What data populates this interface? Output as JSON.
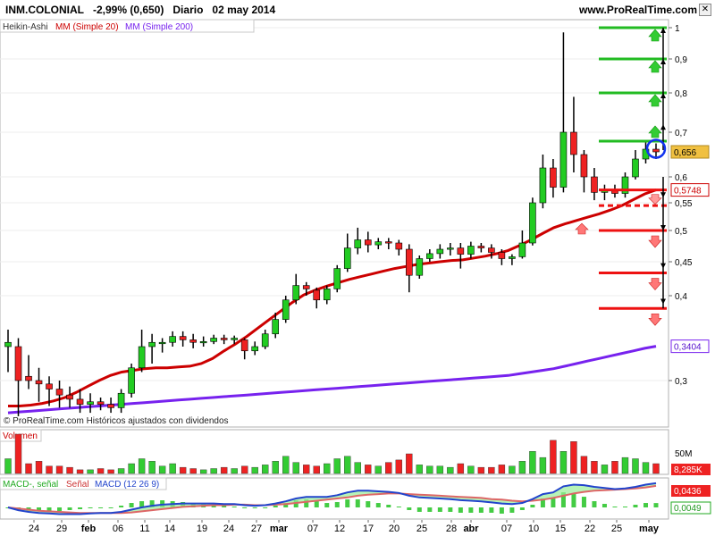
{
  "window": {
    "symbol": "INM.COLONIAL",
    "change": "-2,99% (0,650)",
    "period": "Diario",
    "date": "02 may 2014",
    "site": "www.ProRealTime.com"
  },
  "price_panel": {
    "legend": {
      "heikin": "Heikin-Ashi",
      "ma20": "MM (Simple 20)",
      "ma200": "MM (Simple 200)"
    },
    "watermark": "© ProRealTime.com Históricos ajustados con dividendos",
    "y_ticks": [
      "1",
      "0,9",
      "0,8",
      "0,7",
      "0,6",
      "0,55",
      "0,5",
      "0,45",
      "0,4",
      "0,3"
    ],
    "badges": {
      "last": "0,656",
      "ma20": "0,5748",
      "ma200": "0,3404"
    },
    "colors": {
      "up": "#22cc22",
      "down": "#ee2222",
      "ma20": "#cc0000",
      "ma200": "#7722ee",
      "last_badge": "#f0c040"
    }
  },
  "volume_panel": {
    "title": "Volumen",
    "y_ticks": [
      "50M",
      "8,285K"
    ]
  },
  "macd_panel": {
    "legend": {
      "macd_neg": "MACD-, señal",
      "signal": "Señal",
      "macd": "MACD (12 26 9)"
    },
    "badges": {
      "macd": "0,0436",
      "hist": "0,0049"
    }
  },
  "x_axis": {
    "labels": [
      "24",
      "29",
      "feb",
      "06",
      "11",
      "14",
      "19",
      "24",
      "27",
      "mar",
      "07",
      "12",
      "17",
      "20",
      "25",
      "28",
      "abr",
      "07",
      "10",
      "15",
      "22",
      "25",
      "may"
    ]
  },
  "chart_data": {
    "type": "candlestick",
    "series_ma": [
      {
        "name": "MM (Simple 20)",
        "values": [
          0.27,
          0.27,
          0.271,
          0.273,
          0.276,
          0.28,
          0.286,
          0.293,
          0.3,
          0.306,
          0.31,
          0.312,
          0.314,
          0.315,
          0.315,
          0.316,
          0.317,
          0.32,
          0.326,
          0.335,
          0.343,
          0.352,
          0.362,
          0.372,
          0.382,
          0.392,
          0.401,
          0.408,
          0.414,
          0.419,
          0.424,
          0.428,
          0.432,
          0.436,
          0.44,
          0.443,
          0.446,
          0.448,
          0.45,
          0.452,
          0.453,
          0.456,
          0.459,
          0.463,
          0.468,
          0.476,
          0.485,
          0.495,
          0.505,
          0.512,
          0.518,
          0.524,
          0.53,
          0.537,
          0.545,
          0.556,
          0.567,
          0.5748
        ]
      },
      {
        "name": "MM (Simple 200)",
        "values": [
          0.262,
          0.263,
          0.264,
          0.265,
          0.266,
          0.267,
          0.268,
          0.269,
          0.27,
          0.271,
          0.272,
          0.273,
          0.274,
          0.275,
          0.276,
          0.277,
          0.278,
          0.279,
          0.28,
          0.281,
          0.282,
          0.283,
          0.284,
          0.285,
          0.286,
          0.287,
          0.288,
          0.289,
          0.29,
          0.291,
          0.292,
          0.293,
          0.294,
          0.295,
          0.296,
          0.297,
          0.298,
          0.299,
          0.3,
          0.301,
          0.302,
          0.303,
          0.304,
          0.305,
          0.306,
          0.308,
          0.31,
          0.312,
          0.314,
          0.317,
          0.32,
          0.323,
          0.326,
          0.329,
          0.332,
          0.335,
          0.338,
          0.3404
        ]
      }
    ],
    "candles": [
      {
        "o": 0.34,
        "c": 0.345,
        "h": 0.36,
        "l": 0.31
      },
      {
        "o": 0.34,
        "c": 0.3,
        "h": 0.35,
        "l": 0.258
      },
      {
        "o": 0.305,
        "c": 0.3,
        "h": 0.33,
        "l": 0.29
      },
      {
        "o": 0.3,
        "c": 0.296,
        "h": 0.315,
        "l": 0.275
      },
      {
        "o": 0.296,
        "c": 0.29,
        "h": 0.305,
        "l": 0.27
      },
      {
        "o": 0.29,
        "c": 0.283,
        "h": 0.3,
        "l": 0.268
      },
      {
        "o": 0.283,
        "c": 0.278,
        "h": 0.293,
        "l": 0.268
      },
      {
        "o": 0.278,
        "c": 0.272,
        "h": 0.29,
        "l": 0.262
      },
      {
        "o": 0.272,
        "c": 0.275,
        "h": 0.285,
        "l": 0.262
      },
      {
        "o": 0.275,
        "c": 0.272,
        "h": 0.28,
        "l": 0.265
      },
      {
        "o": 0.272,
        "c": 0.268,
        "h": 0.28,
        "l": 0.262
      },
      {
        "o": 0.268,
        "c": 0.285,
        "h": 0.29,
        "l": 0.262
      },
      {
        "o": 0.285,
        "c": 0.315,
        "h": 0.32,
        "l": 0.28
      },
      {
        "o": 0.315,
        "c": 0.34,
        "h": 0.36,
        "l": 0.31
      },
      {
        "o": 0.34,
        "c": 0.345,
        "h": 0.355,
        "l": 0.32
      },
      {
        "o": 0.345,
        "c": 0.345,
        "h": 0.35,
        "l": 0.333
      },
      {
        "o": 0.345,
        "c": 0.352,
        "h": 0.358,
        "l": 0.34
      },
      {
        "o": 0.352,
        "c": 0.348,
        "h": 0.358,
        "l": 0.34
      },
      {
        "o": 0.348,
        "c": 0.345,
        "h": 0.355,
        "l": 0.338
      },
      {
        "o": 0.345,
        "c": 0.346,
        "h": 0.352,
        "l": 0.34
      },
      {
        "o": 0.346,
        "c": 0.35,
        "h": 0.354,
        "l": 0.343
      },
      {
        "o": 0.35,
        "c": 0.348,
        "h": 0.354,
        "l": 0.343
      },
      {
        "o": 0.348,
        "c": 0.35,
        "h": 0.353,
        "l": 0.343
      },
      {
        "o": 0.348,
        "c": 0.335,
        "h": 0.35,
        "l": 0.325
      },
      {
        "o": 0.335,
        "c": 0.34,
        "h": 0.346,
        "l": 0.33
      },
      {
        "o": 0.34,
        "c": 0.355,
        "h": 0.36,
        "l": 0.337
      },
      {
        "o": 0.355,
        "c": 0.372,
        "h": 0.38,
        "l": 0.35
      },
      {
        "o": 0.372,
        "c": 0.395,
        "h": 0.4,
        "l": 0.368
      },
      {
        "o": 0.395,
        "c": 0.415,
        "h": 0.432,
        "l": 0.39
      },
      {
        "o": 0.415,
        "c": 0.41,
        "h": 0.42,
        "l": 0.4
      },
      {
        "o": 0.408,
        "c": 0.395,
        "h": 0.412,
        "l": 0.385
      },
      {
        "o": 0.395,
        "c": 0.41,
        "h": 0.415,
        "l": 0.39
      },
      {
        "o": 0.41,
        "c": 0.44,
        "h": 0.445,
        "l": 0.405
      },
      {
        "o": 0.44,
        "c": 0.472,
        "h": 0.495,
        "l": 0.435
      },
      {
        "o": 0.472,
        "c": 0.485,
        "h": 0.505,
        "l": 0.462
      },
      {
        "o": 0.485,
        "c": 0.477,
        "h": 0.498,
        "l": 0.465
      },
      {
        "o": 0.477,
        "c": 0.482,
        "h": 0.488,
        "l": 0.47
      },
      {
        "o": 0.482,
        "c": 0.48,
        "h": 0.488,
        "l": 0.47
      },
      {
        "o": 0.48,
        "c": 0.47,
        "h": 0.485,
        "l": 0.46
      },
      {
        "o": 0.47,
        "c": 0.43,
        "h": 0.478,
        "l": 0.405
      },
      {
        "o": 0.43,
        "c": 0.455,
        "h": 0.46,
        "l": 0.425
      },
      {
        "o": 0.455,
        "c": 0.463,
        "h": 0.47,
        "l": 0.45
      },
      {
        "o": 0.463,
        "c": 0.47,
        "h": 0.478,
        "l": 0.455
      },
      {
        "o": 0.47,
        "c": 0.472,
        "h": 0.48,
        "l": 0.46
      },
      {
        "o": 0.472,
        "c": 0.462,
        "h": 0.48,
        "l": 0.44
      },
      {
        "o": 0.462,
        "c": 0.475,
        "h": 0.482,
        "l": 0.455
      },
      {
        "o": 0.475,
        "c": 0.472,
        "h": 0.48,
        "l": 0.465
      },
      {
        "o": 0.472,
        "c": 0.465,
        "h": 0.478,
        "l": 0.455
      },
      {
        "o": 0.465,
        "c": 0.455,
        "h": 0.47,
        "l": 0.445
      },
      {
        "o": 0.455,
        "c": 0.458,
        "h": 0.462,
        "l": 0.445
      },
      {
        "o": 0.458,
        "c": 0.48,
        "h": 0.5,
        "l": 0.455
      },
      {
        "o": 0.48,
        "c": 0.55,
        "h": 0.56,
        "l": 0.476
      },
      {
        "o": 0.55,
        "c": 0.62,
        "h": 0.65,
        "l": 0.54
      },
      {
        "o": 0.62,
        "c": 0.58,
        "h": 0.64,
        "l": 0.56
      },
      {
        "o": 0.58,
        "c": 0.7,
        "h": 0.985,
        "l": 0.57
      },
      {
        "o": 0.7,
        "c": 0.65,
        "h": 0.79,
        "l": 0.61
      },
      {
        "o": 0.65,
        "c": 0.6,
        "h": 0.66,
        "l": 0.57
      },
      {
        "o": 0.6,
        "c": 0.57,
        "h": 0.62,
        "l": 0.555
      },
      {
        "o": 0.57,
        "c": 0.575,
        "h": 0.585,
        "l": 0.555
      },
      {
        "o": 0.575,
        "c": 0.568,
        "h": 0.585,
        "l": 0.56
      },
      {
        "o": 0.568,
        "c": 0.6,
        "h": 0.61,
        "l": 0.56
      },
      {
        "o": 0.6,
        "c": 0.64,
        "h": 0.66,
        "l": 0.595
      },
      {
        "o": 0.64,
        "c": 0.662,
        "h": 0.68,
        "l": 0.63
      },
      {
        "o": 0.662,
        "c": 0.656,
        "h": 0.675,
        "l": 0.64
      }
    ],
    "volume": [
      12,
      32,
      8,
      10,
      6,
      6,
      5,
      3,
      3,
      4,
      3,
      4,
      8,
      12,
      10,
      6,
      8,
      5,
      4,
      3,
      4,
      5,
      4,
      6,
      5,
      7,
      10,
      14,
      9,
      7,
      6,
      8,
      12,
      14,
      9,
      7,
      6,
      9,
      11,
      16,
      7,
      6,
      6,
      5,
      8,
      6,
      5,
      5,
      7,
      6,
      10,
      18,
      13,
      27,
      18,
      26,
      14,
      10,
      7,
      10,
      13,
      12,
      9,
      8
    ],
    "macd": [
      0.0,
      -0.005,
      -0.008,
      -0.01,
      -0.011,
      -0.012,
      -0.012,
      -0.012,
      -0.011,
      -0.01,
      -0.01,
      -0.008,
      -0.004,
      0.0,
      0.003,
      0.005,
      0.006,
      0.007,
      0.007,
      0.007,
      0.007,
      0.006,
      0.006,
      0.004,
      0.003,
      0.004,
      0.007,
      0.011,
      0.016,
      0.019,
      0.019,
      0.019,
      0.022,
      0.027,
      0.03,
      0.03,
      0.029,
      0.028,
      0.026,
      0.021,
      0.018,
      0.017,
      0.016,
      0.015,
      0.013,
      0.012,
      0.011,
      0.009,
      0.007,
      0.006,
      0.008,
      0.015,
      0.024,
      0.027,
      0.038,
      0.041,
      0.04,
      0.037,
      0.035,
      0.033,
      0.034,
      0.037,
      0.041,
      0.0436
    ],
    "signal": [
      0.0,
      -0.002,
      -0.004,
      -0.006,
      -0.007,
      -0.008,
      -0.009,
      -0.01,
      -0.01,
      -0.01,
      -0.01,
      -0.01,
      -0.009,
      -0.007,
      -0.005,
      -0.003,
      -0.001,
      0.001,
      0.002,
      0.003,
      0.004,
      0.004,
      0.005,
      0.005,
      0.004,
      0.004,
      0.005,
      0.006,
      0.008,
      0.01,
      0.012,
      0.014,
      0.016,
      0.018,
      0.021,
      0.023,
      0.024,
      0.025,
      0.025,
      0.024,
      0.023,
      0.022,
      0.021,
      0.02,
      0.019,
      0.018,
      0.017,
      0.015,
      0.014,
      0.012,
      0.011,
      0.012,
      0.014,
      0.017,
      0.021,
      0.025,
      0.028,
      0.03,
      0.031,
      0.032,
      0.033,
      0.034,
      0.036,
      0.0387
    ]
  }
}
